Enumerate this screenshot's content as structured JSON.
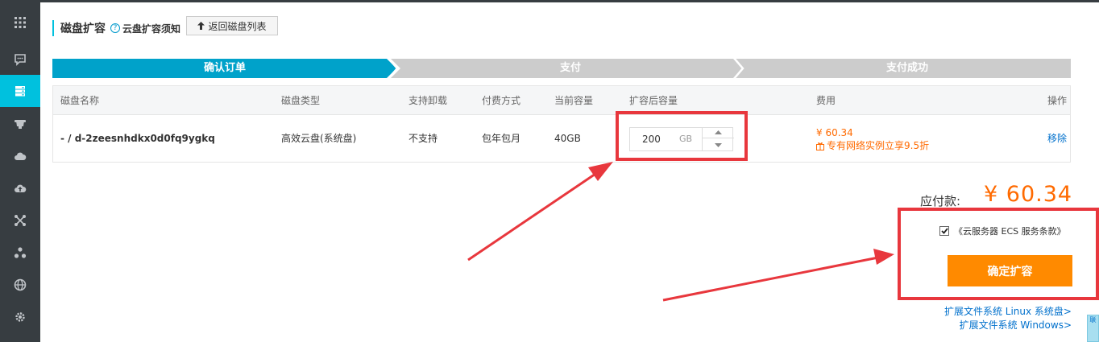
{
  "header": {
    "title": "磁盘扩容",
    "help_link": "云盘扩容须知",
    "back_button": "返回磁盘列表"
  },
  "steps": [
    {
      "label": "确认订单",
      "active": true
    },
    {
      "label": "支付",
      "active": false
    },
    {
      "label": "支付成功",
      "active": false
    }
  ],
  "table": {
    "columns": [
      "磁盘名称",
      "磁盘类型",
      "支持卸载",
      "付费方式",
      "当前容量",
      "扩容后容量",
      "费用",
      "操作"
    ],
    "row": {
      "disk_name": "- / d-2zeesnhdkx0d0fq9ygkq",
      "disk_type": "高效云盘(系统盘)",
      "detachable": "不支持",
      "billing": "包年包月",
      "current_capacity": "40GB",
      "new_capacity_value": "200",
      "new_capacity_unit": "GB",
      "fee": "¥ 60.34",
      "promo": "专有网络实例立享9.5折",
      "action": "移除"
    }
  },
  "summary": {
    "total_label": "应付款:",
    "total_value": "¥ 60.34",
    "terms_checked": true,
    "terms_text": "《云服务器 ECS 服务条款》",
    "confirm_button": "确定扩容",
    "ext_linux": "扩展文件系统 Linux 系统盘>",
    "ext_windows": "扩展文件系统 Windows>"
  },
  "sidebar": {
    "icons": [
      "grid-icon",
      "message-icon",
      "disk-icon",
      "robot-icon",
      "cloud-icon",
      "cloud-upload-icon",
      "network-icon",
      "cluster-icon",
      "globe-icon",
      "gear-icon"
    ],
    "active_index": 2
  },
  "corner_tab": "联",
  "colors": {
    "accent": "#00c1de",
    "sidebar": "#373d41",
    "price": "#ff6a00",
    "confirm": "#ff8a00",
    "link": "#0070cc",
    "annotation": "#e8373d",
    "step_inactive": "#cccccc",
    "step_active": "#00a2ca"
  }
}
